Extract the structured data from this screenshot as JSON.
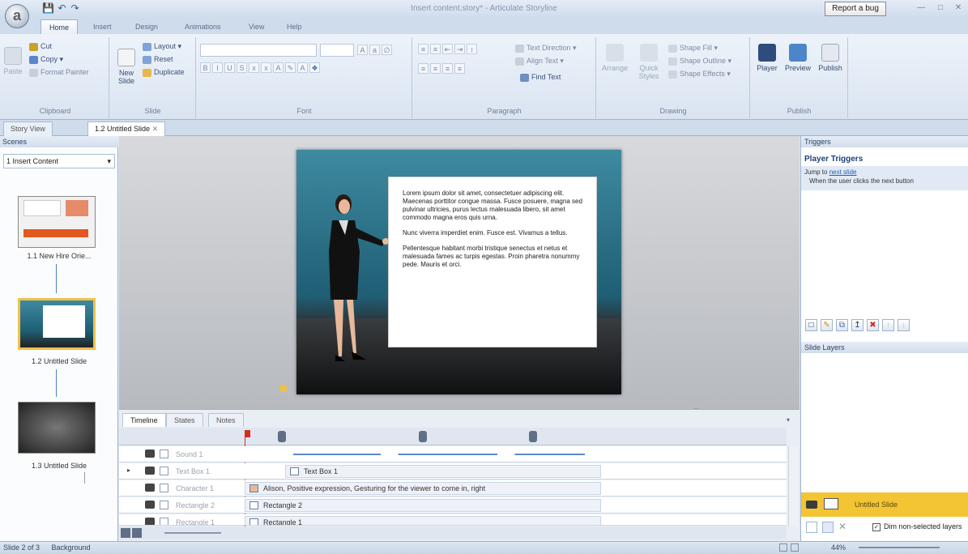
{
  "window": {
    "title": "Insert content.story* - Articulate Storyline",
    "report_bug": "Report a bug"
  },
  "app_button": {
    "label": "a"
  },
  "ribbon_tabs": [
    "Home",
    "Insert",
    "Design",
    "Animations",
    "View",
    "Help"
  ],
  "clipboard": {
    "paste": "Paste",
    "cut": "Cut",
    "copy": "Copy",
    "format_painter": "Format Painter",
    "group": "Clipboard"
  },
  "slide_group": {
    "new_slide": "New Slide",
    "layout": "Layout",
    "reset": "Reset",
    "duplicate": "Duplicate",
    "group": "Slide"
  },
  "font_group": {
    "group": "Font"
  },
  "paragraph_group": {
    "text_direction": "Text Direction",
    "align_text": "Align Text",
    "find_text": "Find Text",
    "group": "Paragraph"
  },
  "drawing_group": {
    "arrange": "Arrange",
    "quick_styles": "Quick Styles",
    "shape_fill": "Shape Fill",
    "shape_outline": "Shape Outline",
    "shape_effects": "Shape Effects",
    "group": "Drawing"
  },
  "publish_group": {
    "player": "Player",
    "preview": "Preview",
    "publish": "Publish",
    "group": "Publish"
  },
  "doc_tabs": {
    "story_view": "Story View",
    "current": "1.2 Untitled Slide"
  },
  "scenes": {
    "header": "Scenes",
    "selected_scene": "1 Insert Content",
    "thumbs": [
      {
        "label": "1.1 New Hire Orie..."
      },
      {
        "label": "1.2 Untitled Slide"
      },
      {
        "label": "1.3 Untitled Slide"
      }
    ]
  },
  "slide": {
    "paragraphs": [
      "Lorem ipsum dolor sit amet, consectetuer adipiscing elit. Maecenas porttitor congue massa. Fusce posuere, magna sed pulvinar ultricies, purus lectus malesuada libero, sit amet commodo magna eros quis urna.",
      "Nunc viverra imperdiet enim. Fusce est. Vivamus a tellus.",
      "Pellentesque habitant morbi tristique senectus et netus et malesuada fames ac turpis egestas. Proin pharetra nonummy pede. Mauris et orci."
    ]
  },
  "timeline": {
    "tabs": [
      "Timeline",
      "States",
      "Notes"
    ],
    "rows": [
      {
        "name": "Sound 1",
        "bar": ""
      },
      {
        "name": "Text Box 1",
        "bar": "Text Box 1"
      },
      {
        "name": "Character 1",
        "bar": "Alison, Positive expression, Gesturing for the viewer to come in, right"
      },
      {
        "name": "Rectangle 2",
        "bar": "Rectangle 2"
      },
      {
        "name": "Rectangle 1",
        "bar": "Rectangle 1"
      }
    ]
  },
  "triggers": {
    "header": "Triggers",
    "title": "Player Triggers",
    "jump_prefix": "Jump to",
    "jump_link": "next slide",
    "when_text": "When the user clicks the next button"
  },
  "layers": {
    "header": "Slide Layers",
    "base_layer": "Untitled Slide",
    "dim_label": "Dim non-selected layers"
  },
  "statusbar": {
    "slide_info": "Slide 2 of 3",
    "background": "Background",
    "zoom": "44%"
  }
}
